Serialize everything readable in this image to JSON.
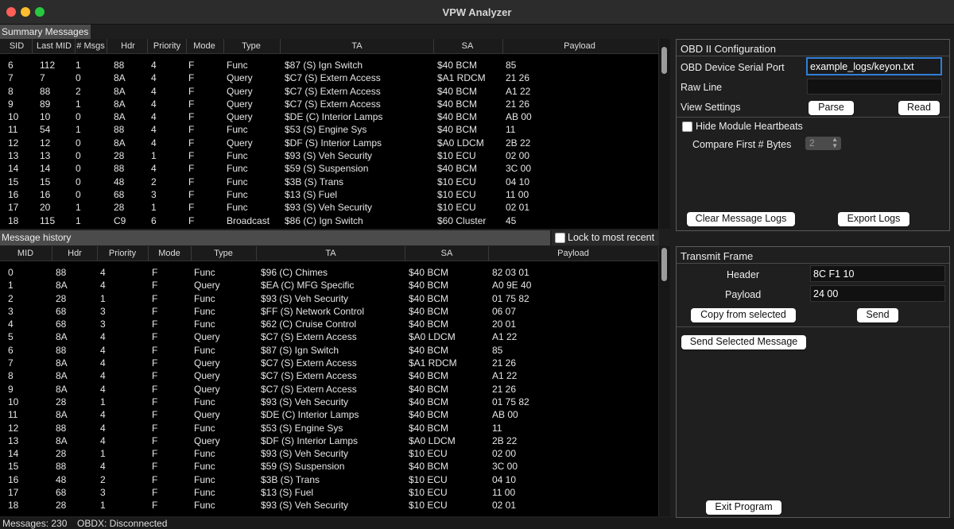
{
  "app": {
    "title": "VPW Analyzer"
  },
  "summary": {
    "label": "Summary Messages",
    "columns": [
      "SID",
      "Last MID",
      "# Msgs",
      "Hdr",
      "Priority",
      "Mode",
      "Type",
      "TA",
      "SA",
      "Payload"
    ],
    "rows": [
      [
        "6",
        "112",
        "1",
        "88",
        "4",
        "F",
        "Func",
        "$87 (S) Ign Switch",
        "$40 BCM",
        "85"
      ],
      [
        "7",
        "7",
        "0",
        "8A",
        "4",
        "F",
        "Query",
        "$C7 (S) Extern Access",
        "$A1 RDCM",
        "21 26"
      ],
      [
        "8",
        "88",
        "2",
        "8A",
        "4",
        "F",
        "Query",
        "$C7 (S) Extern Access",
        "$40 BCM",
        "A1 22"
      ],
      [
        "9",
        "89",
        "1",
        "8A",
        "4",
        "F",
        "Query",
        "$C7 (S) Extern Access",
        "$40 BCM",
        "21 26"
      ],
      [
        "10",
        "10",
        "0",
        "8A",
        "4",
        "F",
        "Query",
        "$DE (C) Interior Lamps",
        "$40 BCM",
        "AB 00"
      ],
      [
        "11",
        "54",
        "1",
        "88",
        "4",
        "F",
        "Func",
        "$53 (S) Engine Sys",
        "$40 BCM",
        "11"
      ],
      [
        "12",
        "12",
        "0",
        "8A",
        "4",
        "F",
        "Query",
        "$DF (S) Interior Lamps",
        "$A0 LDCM",
        "2B 22"
      ],
      [
        "13",
        "13",
        "0",
        "28",
        "1",
        "F",
        "Func",
        "$93 (S) Veh Security",
        "$10 ECU",
        "02 00"
      ],
      [
        "14",
        "14",
        "0",
        "88",
        "4",
        "F",
        "Func",
        "$59 (S) Suspension",
        "$40 BCM",
        "3C 00"
      ],
      [
        "15",
        "15",
        "0",
        "48",
        "2",
        "F",
        "Func",
        "$3B (S) Trans",
        "$10 ECU",
        "04 10"
      ],
      [
        "16",
        "16",
        "0",
        "68",
        "3",
        "F",
        "Func",
        "$13 (S) Fuel",
        "$10 ECU",
        "11 00"
      ],
      [
        "17",
        "20",
        "1",
        "28",
        "1",
        "F",
        "Func",
        "$93 (S) Veh Security",
        "$10 ECU",
        "02 01"
      ],
      [
        "18",
        "115",
        "1",
        "C9",
        "6",
        "F",
        "Broadcast",
        "$86 (C) Ign Switch",
        "$60 Cluster",
        "45"
      ]
    ]
  },
  "history": {
    "label": "Message history",
    "lock_label": "Lock to most recent",
    "columns": [
      "MID",
      "Hdr",
      "Priority",
      "Mode",
      "Type",
      "TA",
      "SA",
      "Payload"
    ],
    "rows": [
      [
        "0",
        "88",
        "4",
        "F",
        "Func",
        "$96 (C) Chimes",
        "$40 BCM",
        "82 03 01"
      ],
      [
        "1",
        "8A",
        "4",
        "F",
        "Query",
        "$EA (C) MFG Specific",
        "$40 BCM",
        "A0 9E 40"
      ],
      [
        "2",
        "28",
        "1",
        "F",
        "Func",
        "$93 (S) Veh Security",
        "$40 BCM",
        "01 75 82"
      ],
      [
        "3",
        "68",
        "3",
        "F",
        "Func",
        "$FF (S) Network Control",
        "$40 BCM",
        "06 07"
      ],
      [
        "4",
        "68",
        "3",
        "F",
        "Func",
        "$62 (C) Cruise Control",
        "$40 BCM",
        "20 01"
      ],
      [
        "5",
        "8A",
        "4",
        "F",
        "Query",
        "$C7 (S) Extern Access",
        "$A0 LDCM",
        "A1 22"
      ],
      [
        "6",
        "88",
        "4",
        "F",
        "Func",
        "$87 (S) Ign Switch",
        "$40 BCM",
        "85"
      ],
      [
        "7",
        "8A",
        "4",
        "F",
        "Query",
        "$C7 (S) Extern Access",
        "$A1 RDCM",
        "21 26"
      ],
      [
        "8",
        "8A",
        "4",
        "F",
        "Query",
        "$C7 (S) Extern Access",
        "$40 BCM",
        "A1 22"
      ],
      [
        "9",
        "8A",
        "4",
        "F",
        "Query",
        "$C7 (S) Extern Access",
        "$40 BCM",
        "21 26"
      ],
      [
        "10",
        "28",
        "1",
        "F",
        "Func",
        "$93 (S) Veh Security",
        "$40 BCM",
        "01 75 82"
      ],
      [
        "11",
        "8A",
        "4",
        "F",
        "Query",
        "$DE (C) Interior Lamps",
        "$40 BCM",
        "AB 00"
      ],
      [
        "12",
        "88",
        "4",
        "F",
        "Func",
        "$53 (S) Engine Sys",
        "$40 BCM",
        "11"
      ],
      [
        "13",
        "8A",
        "4",
        "F",
        "Query",
        "$DF (S) Interior Lamps",
        "$A0 LDCM",
        "2B 22"
      ],
      [
        "14",
        "28",
        "1",
        "F",
        "Func",
        "$93 (S) Veh Security",
        "$10 ECU",
        "02 00"
      ],
      [
        "15",
        "88",
        "4",
        "F",
        "Func",
        "$59 (S) Suspension",
        "$40 BCM",
        "3C 00"
      ],
      [
        "16",
        "48",
        "2",
        "F",
        "Func",
        "$3B (S) Trans",
        "$10 ECU",
        "04 10"
      ],
      [
        "17",
        "68",
        "3",
        "F",
        "Func",
        "$13 (S) Fuel",
        "$10 ECU",
        "11 00"
      ],
      [
        "18",
        "28",
        "1",
        "F",
        "Func",
        "$93 (S) Veh Security",
        "$10 ECU",
        "02 01"
      ]
    ]
  },
  "obd": {
    "title": "OBD II Configuration",
    "serial_port_label": "OBD Device Serial Port",
    "serial_port_value": "example_logs/keyon.txt",
    "raw_line_label": "Raw Line",
    "raw_line_value": "",
    "view_settings_label": "View Settings",
    "parse_label": "Parse",
    "read_label": "Read",
    "hide_heartbeats_label": "Hide Module Heartbeats",
    "hide_heartbeats_checked": false,
    "compare_label": "Compare First # Bytes",
    "compare_value": "2",
    "clear_logs_label": "Clear Message Logs",
    "export_logs_label": "Export Logs"
  },
  "transmit": {
    "title": "Transmit Frame",
    "header_label": "Header",
    "header_value": "8C F1 10",
    "payload_label": "Payload",
    "payload_value": "24 00",
    "copy_label": "Copy from selected",
    "send_label": "Send",
    "send_selected_label": "Send Selected Message",
    "exit_label": "Exit Program"
  },
  "status": {
    "messages": "Messages: 230",
    "obdx": "OBDX: Disconnected"
  }
}
